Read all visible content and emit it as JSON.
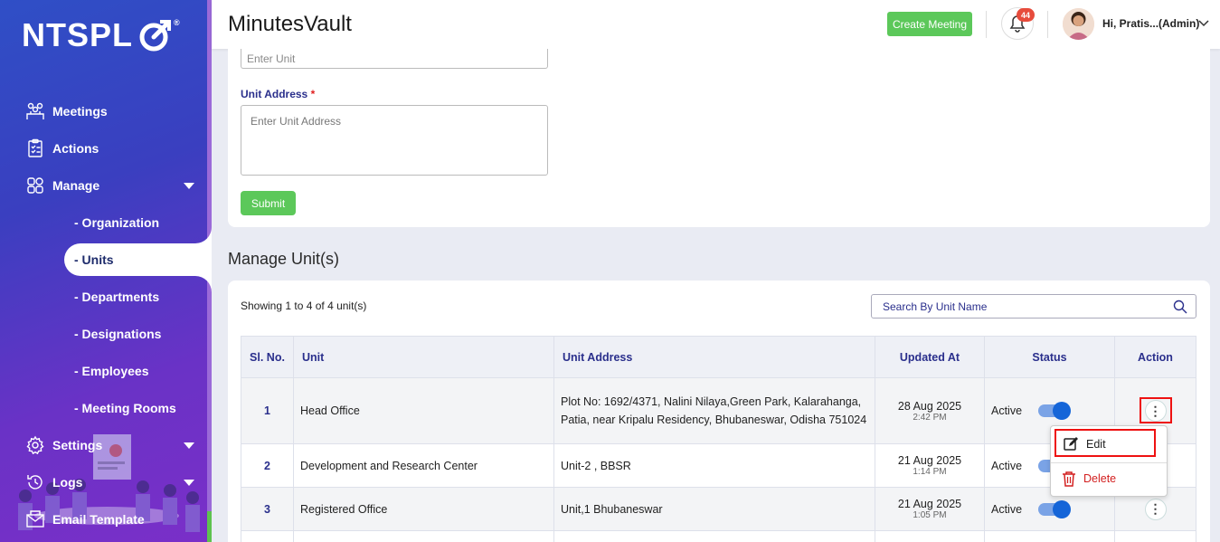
{
  "sidebar": {
    "logo": "NTSPL",
    "logo_mark": "®",
    "items": [
      {
        "label": "Meetings",
        "icon": "meetings-icon"
      },
      {
        "label": "Actions",
        "icon": "actions-icon"
      },
      {
        "label": "Manage",
        "icon": "manage-icon"
      },
      {
        "label": "Settings",
        "icon": "settings-icon"
      },
      {
        "label": "Logs",
        "icon": "logs-icon"
      },
      {
        "label": "Email Template",
        "icon": "email-icon"
      }
    ],
    "sub_items": [
      "- Organization",
      "- Units",
      "- Departments",
      "- Designations",
      "- Employees",
      "- Meeting Rooms"
    ],
    "active": "- Units"
  },
  "header": {
    "title": "MinutesVault",
    "create_label": "Create Meeting",
    "notification_count": "44",
    "user_label": "Hi, Pratis...(Admin)"
  },
  "form": {
    "unit_placeholder": "Enter Unit",
    "address_label": "Unit Address",
    "required_mark": "*",
    "address_placeholder": "Enter Unit Address",
    "submit_label": "Submit"
  },
  "list": {
    "section_title": "Manage Unit(s)",
    "showing": "Showing 1 to 4 of 4 unit(s)",
    "search_placeholder": "Search By Unit Name",
    "columns": [
      "Sl. No.",
      "Unit",
      "Unit Address",
      "Updated At",
      "Status",
      "Action"
    ],
    "rows": [
      {
        "sl": "1",
        "unit": "Head Office",
        "address": "Plot No: 1692/4371, Nalini Nilaya,Green Park, Kalarahanga, Patia, near Kripalu Residency, Bhubaneswar, Odisha 751024",
        "date": "28 Aug 2025",
        "time": "2:42 PM",
        "status": "Active"
      },
      {
        "sl": "2",
        "unit": "Development and Research Center",
        "address": "Unit-2 , BBSR",
        "date": "21 Aug 2025",
        "time": "1:14 PM",
        "status": "Active"
      },
      {
        "sl": "3",
        "unit": "Registered Office",
        "address": "Unit,1 Bhubaneswar",
        "date": "21 Aug 2025",
        "time": "1:05 PM",
        "status": "Active"
      }
    ]
  },
  "action_menu": {
    "edit_label": "Edit",
    "delete_label": "Delete"
  },
  "colors": {
    "accent_green": "#5cc85a",
    "heading_blue": "#2a2f8c",
    "highlight_red": "#e11111",
    "toggle_blue": "#1565d8"
  }
}
